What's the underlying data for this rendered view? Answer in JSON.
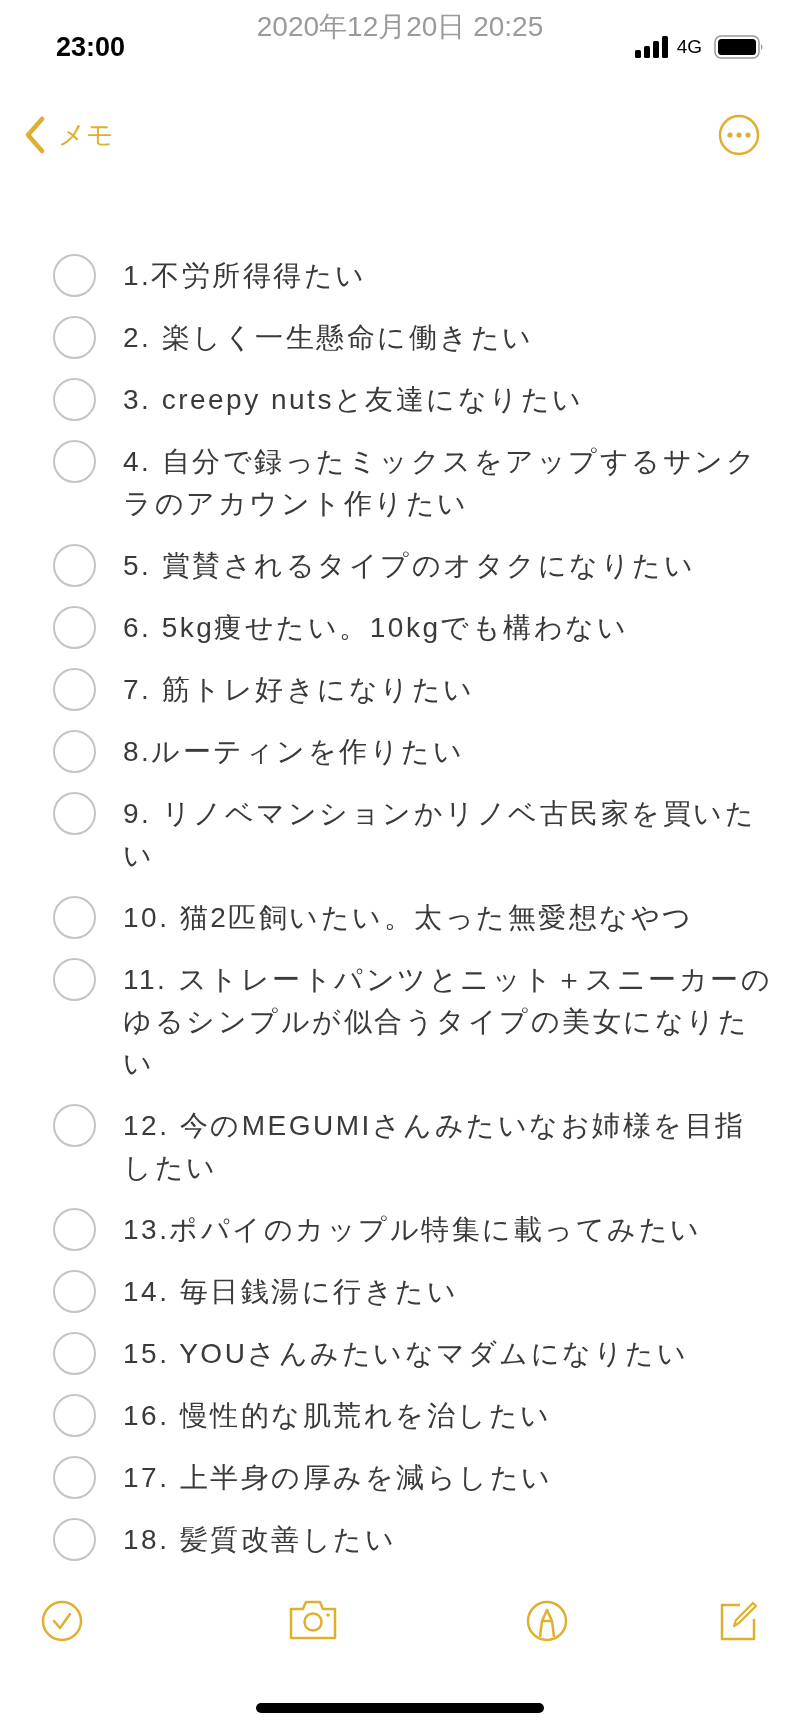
{
  "note_date": "2020年12月20日 20:25",
  "status_bar": {
    "time": "23:00",
    "network": "4G"
  },
  "nav": {
    "back_label": "メモ"
  },
  "checklist": [
    {
      "text": "1.不労所得得たい",
      "checked": false
    },
    {
      "text": "2. 楽しく一生懸命に働きたい",
      "checked": false
    },
    {
      "text": "3. creepy nutsと友達になりたい",
      "checked": false
    },
    {
      "text": "4. 自分で録ったミックスをアップするサンクラのアカウント作りたい",
      "checked": false
    },
    {
      "text": "5. 賞賛されるタイプのオタクになりたい",
      "checked": false
    },
    {
      "text": "6. 5kg痩せたい。10kgでも構わない",
      "checked": false
    },
    {
      "text": "7. 筋トレ好きになりたい",
      "checked": false
    },
    {
      "text": "8.ルーティンを作りたい",
      "checked": false
    },
    {
      "text": "9. リノベマンションかリノベ古民家を買いたい",
      "checked": false
    },
    {
      "text": "10. 猫2匹飼いたい。太った無愛想なやつ",
      "checked": false
    },
    {
      "text": "11. ストレートパンツとニット＋スニーカーのゆるシンプルが似合うタイプの美女になりたい",
      "checked": false
    },
    {
      "text": "12. 今のMEGUMIさんみたいなお姉様を目指したい",
      "checked": false
    },
    {
      "text": "13.ポパイのカップル特集に載ってみたい",
      "checked": false
    },
    {
      "text": "14. 毎日銭湯に行きたい",
      "checked": false
    },
    {
      "text": "15.  YOUさんみたいなマダムになりたい",
      "checked": false
    },
    {
      "text": "16. 慢性的な肌荒れを治したい",
      "checked": false
    },
    {
      "text": "17.  上半身の厚みを減らしたい",
      "checked": false
    },
    {
      "text": "18.  髪質改善したい",
      "checked": false
    }
  ]
}
